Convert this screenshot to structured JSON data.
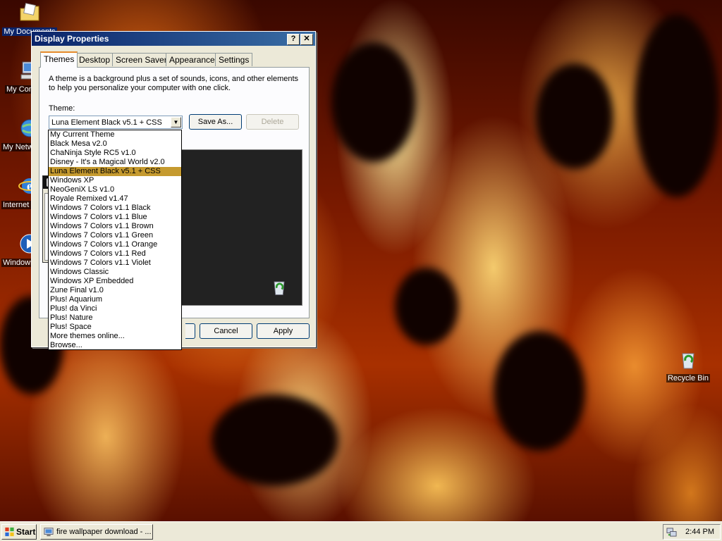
{
  "desktop": {
    "icons": [
      {
        "label": "My Documents",
        "icon": "folder-documents-icon"
      },
      {
        "label": "My Computer",
        "icon": "computer-icon"
      },
      {
        "label": "My Network Places",
        "icon": "network-icon"
      },
      {
        "label": "Internet Explorer",
        "icon": "ie-icon"
      },
      {
        "label": "Windows Media Player",
        "icon": "media-player-icon"
      },
      {
        "label": "Recycle Bin",
        "icon": "recycle-bin-icon"
      }
    ]
  },
  "dialog": {
    "title": "Display Properties",
    "help_button": "?",
    "close_button": "✕",
    "tabs": [
      {
        "label": "Themes",
        "active": true
      },
      {
        "label": "Desktop"
      },
      {
        "label": "Screen Saver"
      },
      {
        "label": "Appearance"
      },
      {
        "label": "Settings"
      }
    ],
    "description": "A theme is a background plus a set of sounds, icons, and other elements to help you personalize your computer with one click.",
    "theme_label": "Theme:",
    "theme_value": "Luna Element Black v5.1 + CSS",
    "save_as_label": "Save As...",
    "delete_label": "Delete",
    "cancel_label": "Cancel",
    "apply_label": "Apply",
    "theme_options": [
      "My Current Theme",
      "Black Mesa v2.0",
      "ChaNinja Style RC5 v1.0",
      "Disney - It's a Magical World v2.0",
      "Luna Element Black v5.1 + CSS",
      "Windows XP",
      "NeoGeniX LS v1.0",
      "Royale Remixed v1.47",
      "Windows 7 Colors v1.1 Black",
      "Windows 7 Colors v1.1 Blue",
      "Windows 7 Colors v1.1 Brown",
      "Windows 7 Colors v1.1 Green",
      "Windows 7 Colors v1.1 Orange",
      "Windows 7 Colors v1.1 Red",
      "Windows 7 Colors v1.1 Violet",
      "Windows Classic",
      "Windows XP Embedded",
      "Zune Final v1.0",
      "Plus! Aquarium",
      "Plus! da Vinci",
      "Plus! Nature",
      "Plus! Space",
      "More themes online...",
      "Browse..."
    ],
    "selected_option_index": 4
  },
  "taskbar": {
    "start_label": "Start",
    "task_label": "fire wallpaper download - ...",
    "clock": "2:44 PM"
  },
  "colors": {
    "titlebar": "#0a246a",
    "selection": "#c59a2f",
    "tab_accent": "#e68b2c"
  }
}
